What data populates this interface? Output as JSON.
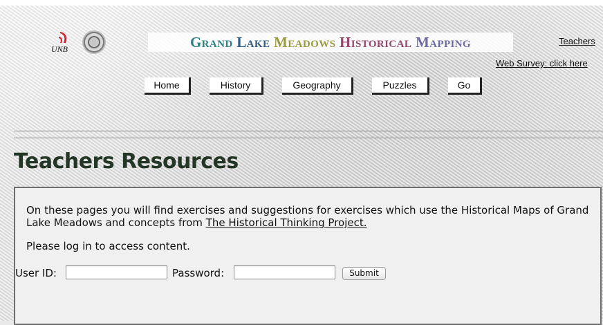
{
  "header": {
    "logo_text": "UNB",
    "title_words": [
      "Grand",
      "Lake",
      "Meadows",
      "Historical",
      "Mapping"
    ],
    "teachers_link": "Teachers",
    "survey_link": "Web Survey: click here"
  },
  "nav": [
    "Home",
    "History",
    "Geography",
    "Puzzles",
    "Go"
  ],
  "main": {
    "title": "Teachers Resources",
    "intro_text": "On these pages you will find exercises and suggestions for exercises which use the Historical Maps of Grand Lake Meadows and concepts from",
    "intro_link": "The Historical Thinking Project.",
    "login_message": "Please log in to access content.",
    "user_label": "User ID:",
    "password_label": "Password:",
    "user_value": "",
    "password_value": "",
    "submit_label": "Submit"
  },
  "colors": {
    "title_dark": "#243626",
    "title_words": [
      "#2f7f86",
      "#2e5d86",
      "#9a9a3e",
      "#96466c",
      "#6e6aa6"
    ]
  }
}
